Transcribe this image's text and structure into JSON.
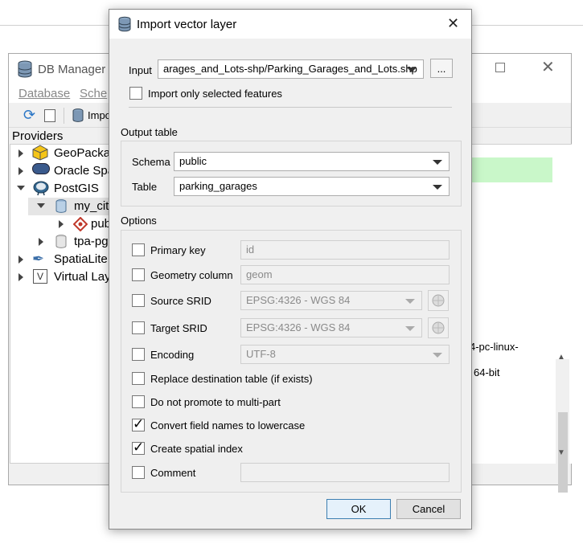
{
  "db_manager": {
    "title": "DB Manager",
    "menu": [
      "Database",
      "Sche"
    ],
    "toolbar_import_label": "Impo",
    "providers_label": "Providers",
    "tree": [
      {
        "label": "GeoPackag",
        "expanded": false
      },
      {
        "label": "Oracle Spa",
        "expanded": false
      },
      {
        "label": "PostGIS",
        "expanded": true
      },
      {
        "label": "my_city",
        "expanded": true
      },
      {
        "label": "pub",
        "expanded": false
      },
      {
        "label": "tpa-pg",
        "expanded": false
      },
      {
        "label": "SpatiaLite",
        "expanded": false
      },
      {
        "label": "Virtual Lay",
        "expanded": false
      }
    ],
    "right_text_1": "4-pc-linux-",
    "right_text_2": "64-bit"
  },
  "dialog": {
    "title": "Import vector layer",
    "input_label": "Input",
    "input_value": "arages_and_Lots-shp/Parking_Garages_and_Lots.shp",
    "browse_label": "...",
    "import_selected_label": "Import only selected features",
    "import_selected_checked": false,
    "output_table_label": "Output table",
    "schema_label": "Schema",
    "schema_value": "public",
    "table_label": "Table",
    "table_value": "parking_garages",
    "options_label": "Options",
    "options": {
      "primary_key": {
        "label": "Primary key",
        "checked": false,
        "value": "id"
      },
      "geometry_column": {
        "label": "Geometry column",
        "checked": false,
        "value": "geom"
      },
      "source_srid": {
        "label": "Source SRID",
        "checked": false,
        "value": "EPSG:4326 - WGS 84"
      },
      "target_srid": {
        "label": "Target SRID",
        "checked": false,
        "value": "EPSG:4326 - WGS 84"
      },
      "encoding": {
        "label": "Encoding",
        "checked": false,
        "value": "UTF-8"
      },
      "replace": {
        "label": "Replace destination table (if exists)",
        "checked": false
      },
      "no_promote": {
        "label": "Do not promote to multi-part",
        "checked": false
      },
      "lowercase": {
        "label": "Convert field names to lowercase",
        "checked": true
      },
      "spatial_index": {
        "label": "Create spatial index",
        "checked": true
      },
      "comment": {
        "label": "Comment",
        "checked": false,
        "value": ""
      }
    },
    "ok_label": "OK",
    "cancel_label": "Cancel",
    "colors": {
      "accent": "#3c7fb1",
      "highlight": "#c9f7c9"
    }
  }
}
